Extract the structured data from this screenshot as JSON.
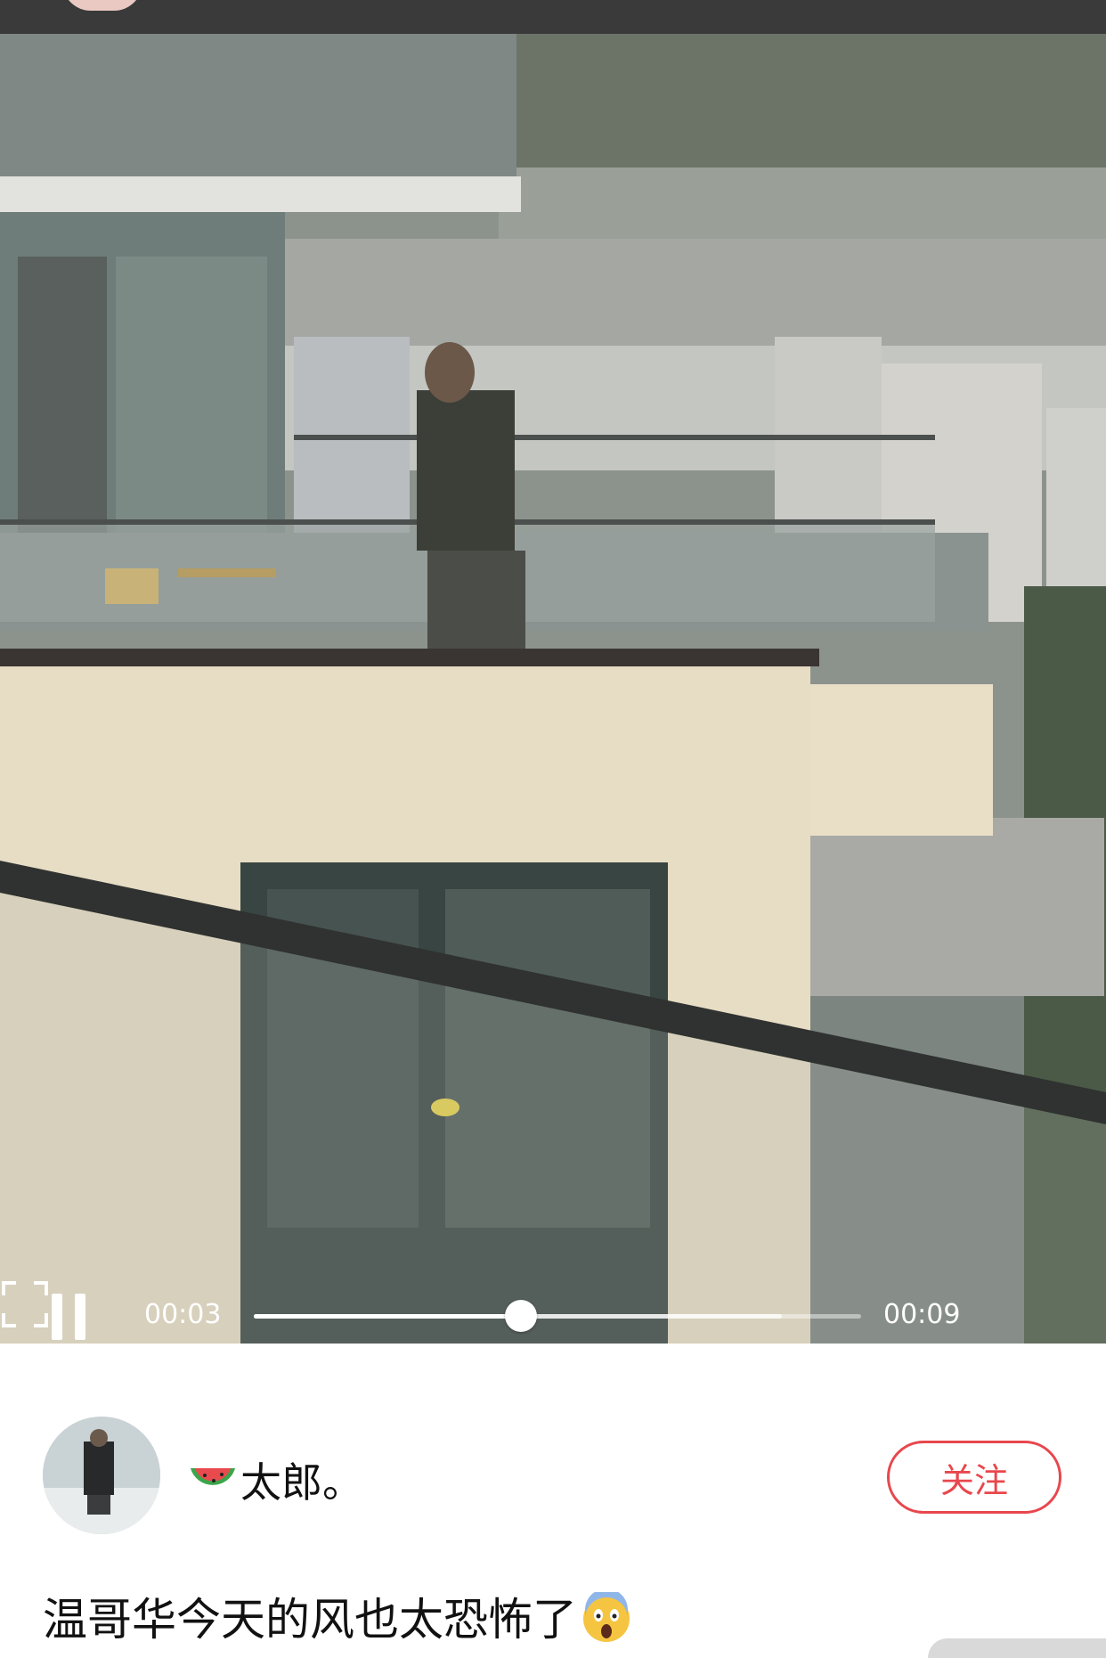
{
  "player": {
    "current_time": "00:03",
    "total_time": "00:09",
    "progress": 0.44,
    "buffered": 0.87
  },
  "post": {
    "author_name": "太郎。",
    "author_badge": "watermelon-emoji",
    "follow_label": "关注",
    "caption": "温哥华今天的风也太恐怖了",
    "caption_emoji": "screaming-face-emoji"
  },
  "colors": {
    "accent": "#e8474d",
    "top_bar": "#3a3a3a"
  }
}
